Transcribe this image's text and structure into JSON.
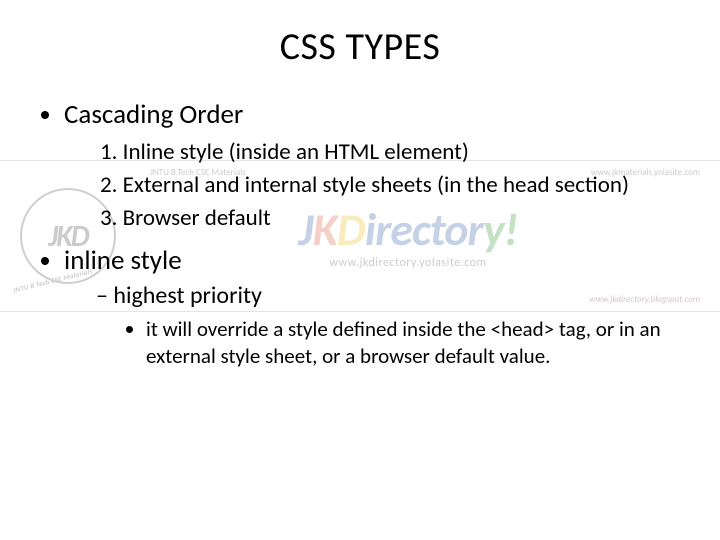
{
  "title": "CSS TYPES",
  "bullets": {
    "b1": "Cascading Order",
    "num1": "1. Inline style (inside an HTML element)",
    "num2": "2. External and internal style sheets (in the head section)",
    "num3": "3. Browser default",
    "b2": "inline style",
    "dash1": "highest priority",
    "sub1": "it will override a style defined inside the <head> tag, or in an external style sheet, or a browser default value."
  },
  "watermark": {
    "logo": "JKD",
    "tag": "JNTU B Tech CSE Materials",
    "mats": "JNTU B.Tech CSE Materials",
    "title_parts": [
      "J",
      "K",
      "D",
      "irector",
      "y!"
    ],
    "sub": "www.jkdirectory.yolasite.com",
    "url_top": "www.jkmaterials.yolasite.com",
    "url_bot": "www.jkdirectory.blogspot.com"
  }
}
